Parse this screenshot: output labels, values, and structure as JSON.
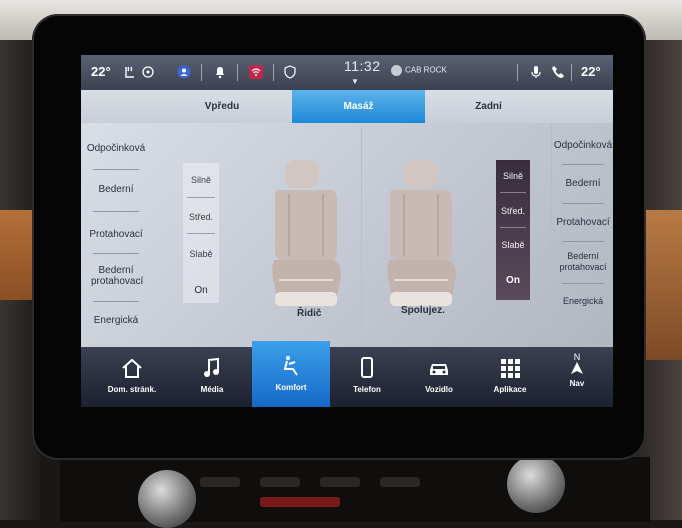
{
  "status_bar": {
    "temp_left": "22°",
    "temp_right": "22°",
    "clock": "11:32",
    "radio_station": "CAB ROCK",
    "icons": [
      "seat-heat-icon",
      "steering-heat-icon",
      "profile-icon",
      "notification-icon",
      "wifi-icon",
      "shield-icon",
      "microphone-icon",
      "phone-icon"
    ]
  },
  "tabs": [
    {
      "label": "Vpředu",
      "active": false
    },
    {
      "label": "Masáž",
      "active": true
    },
    {
      "label": "Zadní",
      "active": false
    }
  ],
  "driver": {
    "programs": [
      "Odpočinková",
      "Bederní",
      "Protahovací",
      "Bederní protahovací",
      "Energická"
    ],
    "intensity": [
      "Silně",
      "Střed.",
      "Slabě"
    ],
    "state": "On",
    "seat_label": "Řidič"
  },
  "passenger": {
    "programs": [
      "Odpočinková",
      "Bederní",
      "Protahovací",
      "Bederní protahovací",
      "Energická"
    ],
    "intensity": [
      "Silně",
      "Střed.",
      "Slabě"
    ],
    "state": "On",
    "seat_label": "Spolujez."
  },
  "nav": [
    {
      "label": "Dom. stránk.",
      "icon": "home-icon",
      "active": false
    },
    {
      "label": "Média",
      "icon": "music-note-icon",
      "active": false
    },
    {
      "label": "Komfort",
      "icon": "comfort-seat-icon",
      "active": true
    },
    {
      "label": "Telefon",
      "icon": "phone-device-icon",
      "active": false
    },
    {
      "label": "Vozidlo",
      "icon": "car-icon",
      "active": false
    },
    {
      "label": "Aplikace",
      "icon": "apps-grid-icon",
      "active": false
    },
    {
      "label": "Nav",
      "icon": "compass-icon",
      "active": false,
      "heading": "N"
    }
  ],
  "colors": {
    "accent": "#1e88d8",
    "navbar": "#1c2030",
    "intensity_active_bg": "#3a2e3c"
  }
}
